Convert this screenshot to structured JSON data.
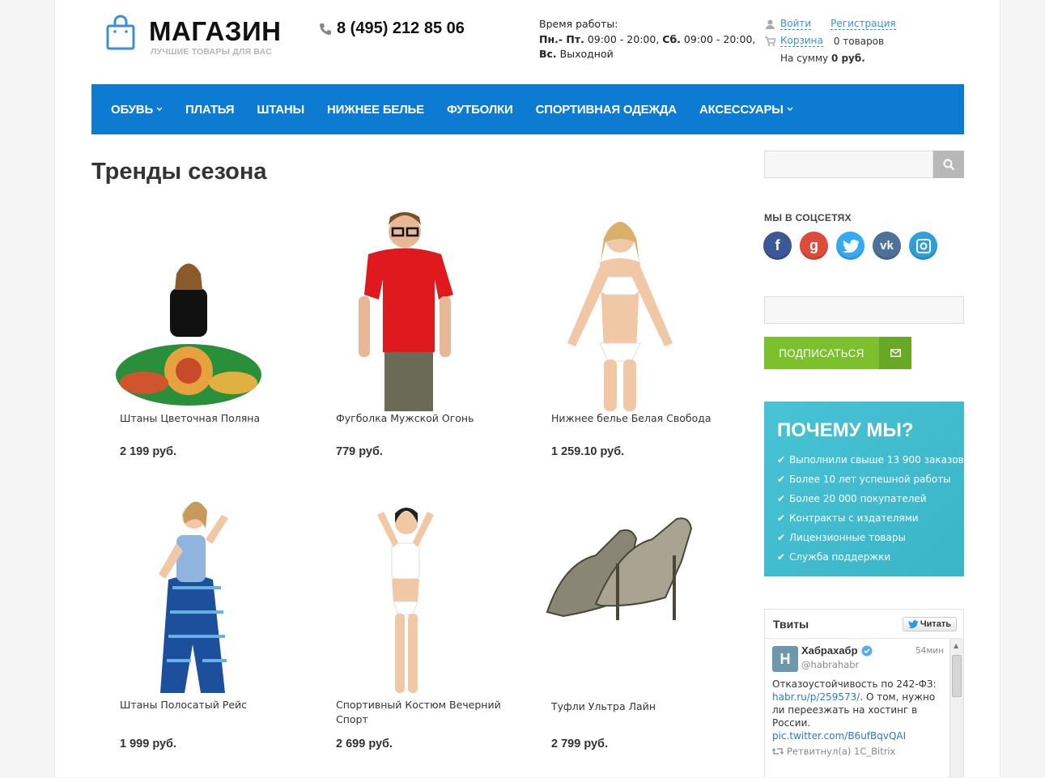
{
  "header": {
    "logo_title": "МАГАЗИН",
    "logo_sub": "ЛУЧШИЕ ТОВАРЫ ДЛЯ ВАС",
    "phone": "8 (495) 212 85 06",
    "hours_label": "Время работы:",
    "hours_days1": "Пн.- Пт.",
    "hours_time1": " 09:00 - 20:00, ",
    "hours_days2": "Сб.",
    "hours_time2": " 09:00 - 20:00,",
    "hours_days3": "Вс.",
    "hours_time3": " Выходной",
    "login": "Войти",
    "register": "Регистрация",
    "cart": "Корзина",
    "cart_count": "0 товаров",
    "cart_sum_label": "На сумму",
    "cart_sum": "0 руб."
  },
  "nav": {
    "items": [
      {
        "label": "ОБУВЬ"
      },
      {
        "label": "ПЛАТЬЯ"
      },
      {
        "label": "ШТАНЫ"
      },
      {
        "label": "НИЖНЕЕ БЕЛЬЕ"
      },
      {
        "label": "ФУТБОЛКИ"
      },
      {
        "label": "СПОРТИВНАЯ ОДЕЖДА"
      },
      {
        "label": "АКСЕССУАРЫ"
      }
    ]
  },
  "main": {
    "title": "Тренды сезона",
    "products": [
      {
        "name": "Штаны Цветочная Поляна",
        "price": "2 199 руб."
      },
      {
        "name": "Фугболка Мужской Огонь",
        "price": "779 руб."
      },
      {
        "name": "Нижнее белье Белая Свобода",
        "price": "1 259.10 руб."
      },
      {
        "name": "Штаны Полосатый Рейс",
        "price": "1 999 руб."
      },
      {
        "name": "Спортивный Костюм Вечерний Спорт",
        "price": "2 699 руб."
      },
      {
        "name": "Туфли Ультра Лайн",
        "price": "2 799 руб."
      }
    ]
  },
  "sidebar": {
    "social_title": "МЫ В СОЦСЕТЯХ",
    "socials": [
      {
        "icon": "facebook-icon",
        "glyph": "f",
        "color": "#3b5998"
      },
      {
        "icon": "google-plus-icon",
        "glyph": "g",
        "color": "#dd4b39"
      },
      {
        "icon": "twitter-icon",
        "glyph": "t",
        "color": "#33aaf1"
      },
      {
        "icon": "vk-icon",
        "glyph": "vk",
        "color": "#4d7198"
      },
      {
        "icon": "instagram-icon",
        "glyph": "◎",
        "color": "#2e9fd8"
      }
    ],
    "subscribe_label": "ПОДПИСАТЬСЯ",
    "why_title": "ПОЧЕМУ МЫ?",
    "why_items": [
      "Выполнили свыше 13 900 заказов",
      "Более 10 лет успешной работы",
      "Более 20 000 покупателей",
      "Контракты с издателями",
      "Лицензионные товары",
      "Служба поддержки"
    ]
  },
  "tweets": {
    "title": "Твиты",
    "follow": "Читать",
    "avatar": "H",
    "name": "Хабрахабр",
    "handle": "@habrahabr",
    "time": "54мин",
    "text1": "Отказоустойчивость по 242-ФЗ:",
    "link1": "habr.ru/p/259573/",
    "text2": ". О том, нужно ли переезжать на хостинг в России.",
    "link2": "pic.twitter.com/B6ufBqvQAI",
    "retweet": "Ретвитнул(а) 1C_Bitrix"
  }
}
